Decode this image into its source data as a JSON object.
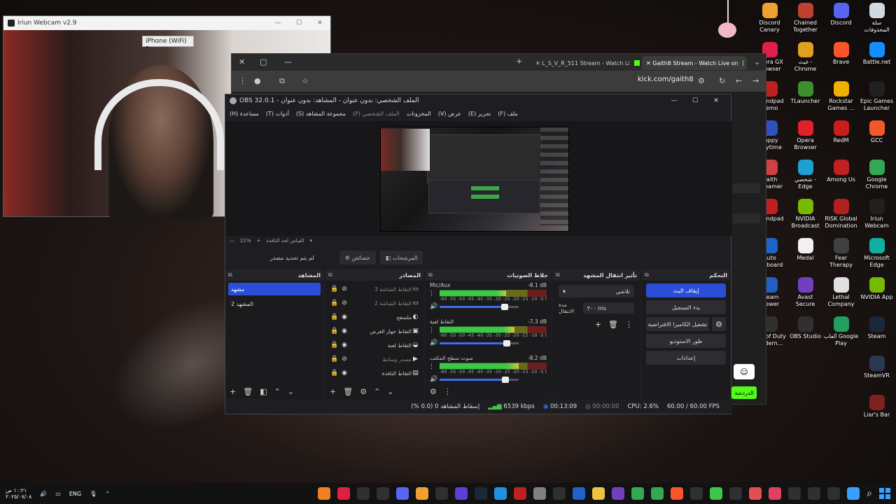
{
  "desktop_icons": [
    {
      "label": "Discord Canary",
      "color": "#f0a030"
    },
    {
      "label": "Chained Together",
      "color": "#c04030"
    },
    {
      "label": "Discord",
      "color": "#5865f2"
    },
    {
      "label": "سلة المحذوفات",
      "color": "#d0d8e0"
    },
    {
      "label": "Opera GX Browser",
      "color": "#e0204a"
    },
    {
      "label": "غيث - Chrome",
      "color": "#e0a020"
    },
    {
      "label": "Brave",
      "color": "#fb542b"
    },
    {
      "label": "Battle.net",
      "color": "#148eff"
    },
    {
      "label": "Roundpad Demo",
      "color": "#c02020"
    },
    {
      "label": "TLauncher",
      "color": "#3e8e2e"
    },
    {
      "label": "Rockstar Games ...",
      "color": "#f0b000"
    },
    {
      "label": "Epic Games Launcher",
      "color": "#202020"
    },
    {
      "label": "Poppy Playtime",
      "color": "#3050c0"
    },
    {
      "label": "Opera Browser",
      "color": "#e0202a"
    },
    {
      "label": "RedM",
      "color": "#c81e1e"
    },
    {
      "label": "GCC",
      "color": "#f05a28"
    },
    {
      "label": "Gaith Streamer book",
      "color": "#d04040"
    },
    {
      "label": "شخصي - Edge",
      "color": "#1ea0d0"
    },
    {
      "label": "Among Us",
      "color": "#c02020"
    },
    {
      "label": "Google Chrome",
      "color": "#34a853"
    },
    {
      "label": "Roundpad",
      "color": "#c02020"
    },
    {
      "label": "NVIDIA Broadcast",
      "color": "#76b900"
    },
    {
      "label": "RISK Global Domination",
      "color": "#b02020"
    },
    {
      "label": "Iriun Webcam",
      "color": "#202020"
    },
    {
      "label": "Auto Keyboard",
      "color": "#1e64c8"
    },
    {
      "label": "Medal",
      "color": "#f0f0f0"
    },
    {
      "label": "Fear Therapy",
      "color": "#404040"
    },
    {
      "label": "Microsoft Edge",
      "color": "#0fb0a0"
    },
    {
      "label": "Steam Viewer",
      "color": "#2060c0"
    },
    {
      "label": "Avast Secure Browser",
      "color": "#7040c0"
    },
    {
      "label": "Lethal Company",
      "color": "#e0e0e0"
    },
    {
      "label": "NVIDIA App",
      "color": "#76b900"
    },
    {
      "label": "Call of Duty Modern...",
      "color": "#303030"
    },
    {
      "label": "OBS Studio",
      "color": "#303030"
    },
    {
      "label": "ألعاب Google Play",
      "color": "#20a060"
    },
    {
      "label": "Steam",
      "color": "#1b2838"
    },
    {
      "label": "",
      "color": "transparent"
    },
    {
      "label": "",
      "color": "transparent"
    },
    {
      "label": "",
      "color": "transparent"
    },
    {
      "label": "SteamVR",
      "color": "#2a3850"
    },
    {
      "label": "",
      "color": "transparent"
    },
    {
      "label": "",
      "color": "transparent"
    },
    {
      "label": "",
      "color": "transparent"
    },
    {
      "label": "Liar's Bar",
      "color": "#802020"
    }
  ],
  "webcam": {
    "title": "Iriun Webcam v2.9",
    "device_select": "iPhone (WiFi)"
  },
  "browser": {
    "tabs": [
      {
        "title": "L_S_V_R_511 Stream - Watch Li"
      },
      {
        "title": "Gaith8 Stream - Watch Live on"
      }
    ],
    "url": "kick.com/gaith8",
    "chat_button": "الدردشة"
  },
  "obs": {
    "title": "OBS 32.0.1 - الملف الشخصي: بدون عنوان - المشاهد: بدون عنوان",
    "menu": [
      "ملف (F)",
      "تحرير (E)",
      "عرض (V)",
      "المخزونات",
      "الملف الشخصي (P)",
      "مجموعة المشاهد (S)",
      "أدوات (T)",
      "مساعدة (H)"
    ],
    "zoom": "21%",
    "zoom_label": "القياس لحد النافذة",
    "context": {
      "no_source": "لم يتم تحديد مصدر",
      "properties": "خصائص",
      "filters": "المرشحات"
    },
    "docks": {
      "scenes": {
        "title": "المشاهد",
        "items": [
          "مشهد",
          "المشهد 2"
        ]
      },
      "sources": {
        "title": "المصادر",
        "items": [
          {
            "name": "التقاط الشاشة 3",
            "icon": "monitor",
            "hidden": true
          },
          {
            "name": "التقاط الشاشة 2",
            "icon": "monitor",
            "hidden": true
          },
          {
            "name": "ملصقح",
            "icon": "palette",
            "hidden": false
          },
          {
            "name": "التقاط جهاز الغرض",
            "icon": "camera",
            "hidden": false
          },
          {
            "name": "التقاط لعبة",
            "icon": "gamepad",
            "hidden": false
          },
          {
            "name": "مصدر وسائط",
            "icon": "play",
            "hidden": true
          },
          {
            "name": "التقاط النافذة",
            "icon": "window",
            "hidden": false
          }
        ]
      },
      "mixer": {
        "title": "خلاط الصوتيات",
        "channels": [
          {
            "name": "Mic/Aux",
            "db": "-8.1 dB",
            "level": 0.62,
            "volume": 0.82
          },
          {
            "name": "التقاط لعبة",
            "db": "-7.3 dB",
            "level": 0.7,
            "volume": 0.85
          },
          {
            "name": "صوت سطح المكتب",
            "db": "-8.2 dB",
            "level": 0.74,
            "volume": 0.83
          }
        ],
        "scale": "-60 -55 -50 -45 -40 -35 -30 -25 -20 -15 -10 -5 0"
      },
      "transitions": {
        "title": "تأثير انتقال المشهد",
        "selected": "تلاشي",
        "duration_label": "مدة الانتقال",
        "duration_value": "٣٠٠ ms"
      },
      "controls": {
        "title": "التحكم",
        "stop_stream": "إيقاف البث",
        "start_record": "بدء التسجيل",
        "virtual_cam": "تشغيل الكاميرا الافتراضية",
        "studio_mode": "طور الاستوديو",
        "settings": "إعدادات"
      }
    },
    "status": {
      "dropped": "إسقاط المشاهد 0 (0.0 %)",
      "bitrate": "6539 kbps",
      "stream_time": "00:13:09",
      "record_time": "00:00:00",
      "cpu": "CPU: 2.6%",
      "fps": "60.00 / 60.00 FPS"
    }
  },
  "taskbar": {
    "clock_time": "١٠:٢١ ص",
    "clock_date": "٢٠٢٥/٠٧/٠٨",
    "lang": "ENG",
    "apps": [
      "#f08020",
      "#e02040",
      "#303030",
      "#303030",
      "#5865f2",
      "#f0a030",
      "#303030",
      "#5b3fd6",
      "#1b2838",
      "#2090e0",
      "#c02020",
      "#808080",
      "#303030",
      "#1e64c8",
      "#f0c040",
      "#7040c0",
      "#34a853",
      "#34a853",
      "#fb542b",
      "#303030",
      "#3ec648",
      "#303030",
      "#e05050",
      "#e04060",
      "#303030",
      "#303030",
      "#303030",
      "#3aa0ff"
    ]
  }
}
